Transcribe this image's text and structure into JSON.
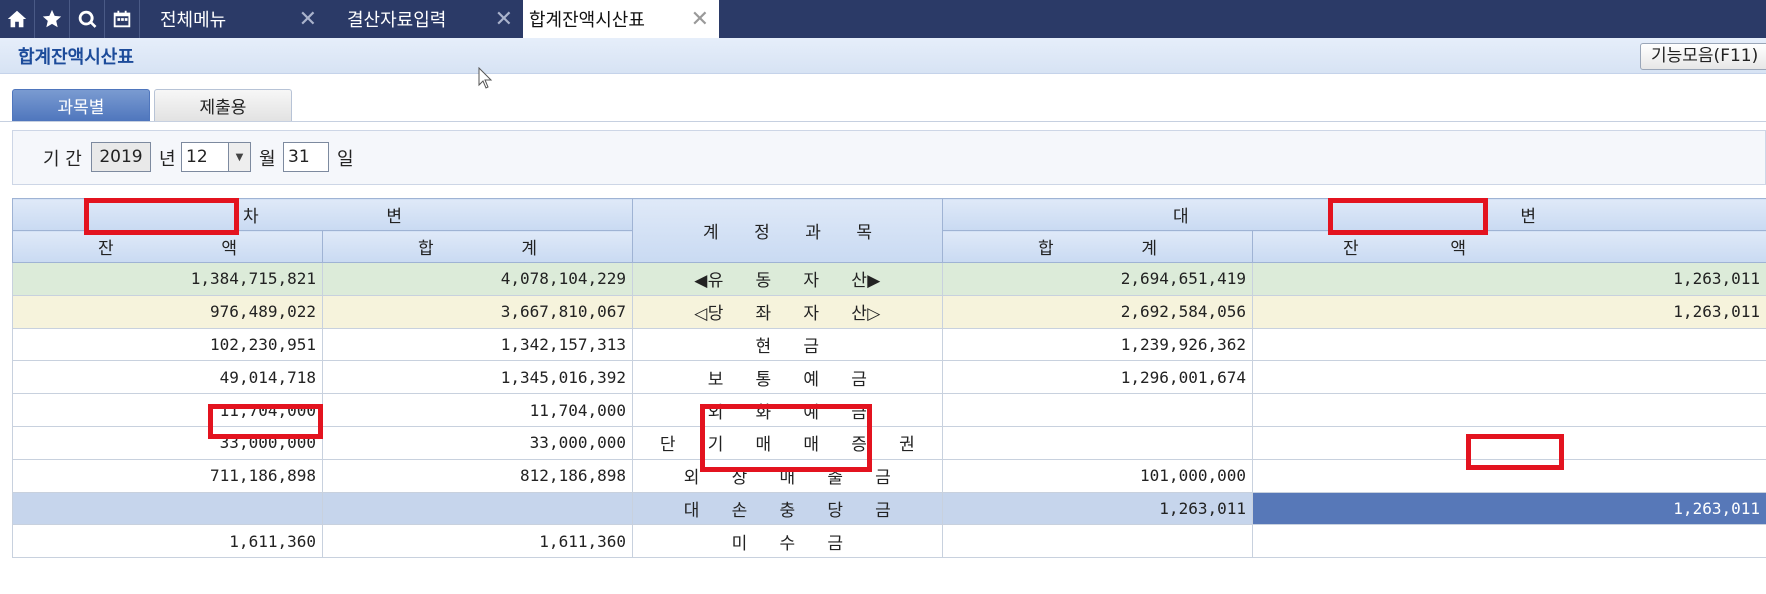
{
  "topbar": {
    "icons": [
      "home-icon",
      "star-icon",
      "search-icon",
      "calendar-icon"
    ],
    "tabs": [
      {
        "label": "전체메뉴",
        "closable": true,
        "active": false
      },
      {
        "label": "결산자료입력",
        "closable": true,
        "active": false
      },
      {
        "label": "합계잔액시산표",
        "closable": true,
        "active": true
      }
    ],
    "close_symbol": "✕"
  },
  "page": {
    "title": "합계잔액시산표",
    "function_button": "기능모음(F11)"
  },
  "subtabs": [
    {
      "label": "과목별",
      "active": true
    },
    {
      "label": "제출용",
      "active": false
    }
  ],
  "filter": {
    "period_label": "기 간",
    "year": "2019",
    "year_unit": "년",
    "month": "12",
    "month_unit": "월",
    "day": "31",
    "day_unit": "일"
  },
  "table": {
    "headers": {
      "debit": [
        "차",
        "변"
      ],
      "debit_balance": [
        "잔",
        "액"
      ],
      "debit_total": [
        "합",
        "계"
      ],
      "account": [
        "계",
        "정",
        "과",
        "목"
      ],
      "credit": [
        "대",
        "변"
      ],
      "credit_total": [
        "합",
        "계"
      ],
      "credit_balance": [
        "잔",
        "액"
      ]
    },
    "rows": [
      {
        "debit_balance": "1,384,715,821",
        "debit_total": "4,078,104,229",
        "account": "◀유 동 자 산▶",
        "credit_total": "2,694,651,419",
        "credit_balance": "1,263,011",
        "style": "green"
      },
      {
        "debit_balance": "976,489,022",
        "debit_total": "3,667,810,067",
        "account": "◁당 좌 자 산▷",
        "credit_total": "2,692,584,056",
        "credit_balance": "1,263,011",
        "style": "yellow"
      },
      {
        "debit_balance": "102,230,951",
        "debit_total": "1,342,157,313",
        "account": "현 금",
        "credit_total": "1,239,926,362",
        "credit_balance": "",
        "style": "plain"
      },
      {
        "debit_balance": "49,014,718",
        "debit_total": "1,345,016,392",
        "account": "보 통 예 금",
        "credit_total": "1,296,001,674",
        "credit_balance": "",
        "style": "plain"
      },
      {
        "debit_balance": "11,704,000",
        "debit_total": "11,704,000",
        "account": "외 화 예 금",
        "credit_total": "",
        "credit_balance": "",
        "style": "plain"
      },
      {
        "debit_balance": "33,000,000",
        "debit_total": "33,000,000",
        "account": "단 기 매 매 증 권",
        "credit_total": "",
        "credit_balance": "",
        "style": "plain"
      },
      {
        "debit_balance": "711,186,898",
        "debit_total": "812,186,898",
        "account": "외 상 매 출 금",
        "credit_total": "101,000,000",
        "credit_balance": "",
        "style": "plain"
      },
      {
        "debit_balance": "",
        "debit_total": "",
        "account": "대 손 충 당 금",
        "credit_total": "1,263,011",
        "credit_balance": "1,263,011",
        "style": "selected"
      },
      {
        "debit_balance": "1,611,360",
        "debit_total": "1,611,360",
        "account": "미 수 금",
        "credit_total": "",
        "credit_balance": "",
        "style": "plain"
      }
    ]
  },
  "colors": {
    "topbar": "#2b3a67",
    "highlight_box": "#e3131f",
    "selected_cell": "#5778b8"
  }
}
